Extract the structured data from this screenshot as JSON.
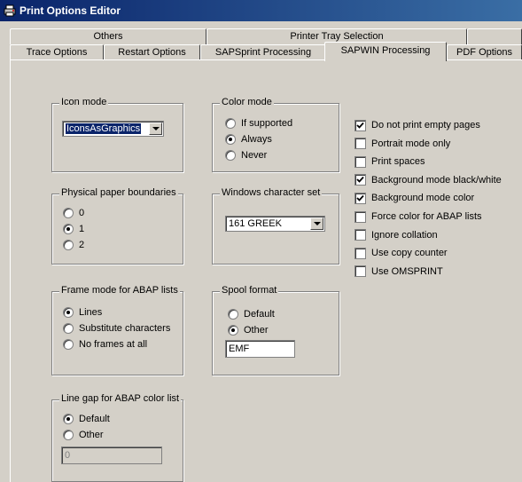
{
  "window": {
    "title": "Print Options Editor",
    "icon": "printer-icon"
  },
  "tabs": {
    "row_back": [
      "Others",
      "Printer Tray Selection",
      ""
    ],
    "row_front": [
      "Trace Options",
      "Restart Options",
      "SAPSprint Processing",
      "SAPWIN Processing",
      "PDF Options"
    ],
    "active": "SAPWIN Processing"
  },
  "icon_mode": {
    "legend": "Icon mode",
    "selected": "IconsAsGraphics"
  },
  "color_mode": {
    "legend": "Color mode",
    "options": [
      "If supported",
      "Always",
      "Never"
    ],
    "selected": "Always"
  },
  "paper_boundaries": {
    "legend": "Physical paper boundaries",
    "options": [
      "0",
      "1",
      "2"
    ],
    "selected": "1"
  },
  "charset": {
    "legend": "Windows character set",
    "selected": "161 GREEK"
  },
  "frame_mode": {
    "legend": "Frame mode for ABAP lists",
    "options": [
      "Lines",
      "Substitute characters",
      "No frames at all"
    ],
    "selected": "Lines"
  },
  "spool_format": {
    "legend": "Spool format",
    "options": [
      "Default",
      "Other"
    ],
    "selected": "Other",
    "other_value": "EMF"
  },
  "line_gap": {
    "legend": "Line gap for ABAP color list",
    "options": [
      "Default",
      "Other"
    ],
    "selected": "Default",
    "other_value": "0"
  },
  "checkboxes": [
    {
      "label": "Do not print empty pages",
      "checked": true
    },
    {
      "label": "Portrait mode only",
      "checked": false
    },
    {
      "label": "Print spaces",
      "checked": false
    },
    {
      "label": "Background mode black/white",
      "checked": true
    },
    {
      "label": "Background mode color",
      "checked": true
    },
    {
      "label": "Force color for ABAP lists",
      "checked": false
    },
    {
      "label": "Ignore collation",
      "checked": false
    },
    {
      "label": "Use copy counter",
      "checked": false
    },
    {
      "label": "Use OMSPRINT",
      "checked": false
    }
  ]
}
